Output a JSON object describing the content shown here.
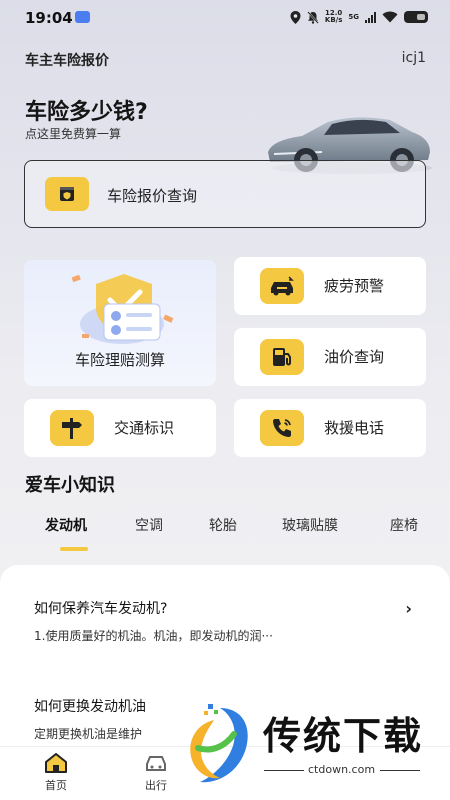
{
  "status_bar": {
    "time": "19:04",
    "net_speed_value": "12.0",
    "net_speed_unit": "KB/s",
    "network": "5G"
  },
  "header": {
    "title": "车主车险报价",
    "user": "icj1"
  },
  "hero": {
    "title": "车险多少钱?",
    "subtitle": "点这里免费算一算"
  },
  "quote_card": {
    "label": "车险报价查询",
    "icon": "shield-document-icon"
  },
  "services": {
    "claim": {
      "label": "车险理赔测算",
      "icon": "claim-illustration"
    },
    "fatigue": {
      "label": "疲劳预警",
      "icon": "car-alert-icon"
    },
    "fuel": {
      "label": "油价查询",
      "icon": "fuel-pump-icon"
    },
    "signs": {
      "label": "交通标识",
      "icon": "signpost-icon"
    },
    "rescue": {
      "label": "救援电话",
      "icon": "phone-call-icon"
    }
  },
  "knowledge": {
    "title": "爱车小知识",
    "tabs": [
      "发动机",
      "空调",
      "轮胎",
      "玻璃贴膜",
      "座椅"
    ],
    "active_tab": "发动机",
    "articles": [
      {
        "title": "如何保养汽车发动机?",
        "excerpt": "1.使用质量好的机油。机油，即发动机的润···"
      },
      {
        "title": "如何更换发动机油",
        "excerpt": "定期更换机油是维护"
      }
    ]
  },
  "bottom_nav": {
    "items": [
      "首页",
      "出行"
    ]
  },
  "watermark": {
    "text": "传统下载",
    "domain": "ctdown.com"
  },
  "colors": {
    "accent": "#f5c842",
    "background": "#e6e6ee",
    "card": "#ffffff"
  }
}
